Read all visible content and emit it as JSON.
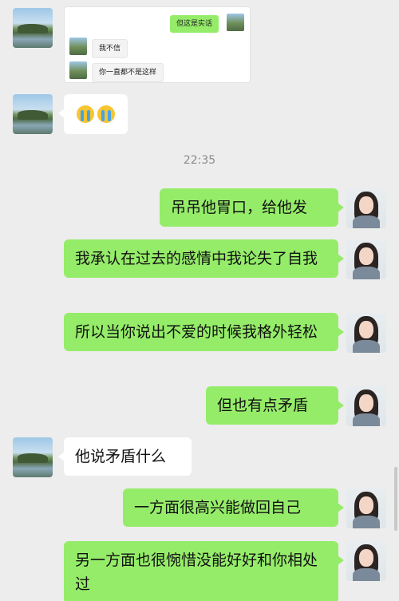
{
  "quote": {
    "sent_text": "但这是实话",
    "reply1": "我不信",
    "reply2": "你一直都不是这样"
  },
  "emoji_message": {
    "icon": "crying-face-icon"
  },
  "timestamp": "22:35",
  "messages": [
    {
      "side": "right",
      "text": "吊吊他胃口，给他发"
    },
    {
      "side": "right",
      "text": "我承认在过去的感情中我论失了自我"
    },
    {
      "side": "right",
      "text": "所以当你说出不爱的时候我格外轻松"
    },
    {
      "side": "right",
      "text": "但也有点矛盾"
    },
    {
      "side": "left",
      "text": "他说矛盾什么"
    },
    {
      "side": "right",
      "text": "一方面很高兴能做回自己"
    },
    {
      "side": "right",
      "text": "另一方面也很惋惜没能好好和你相处过"
    }
  ],
  "colors": {
    "background": "#ededed",
    "sent_bubble": "#95ec69",
    "received_bubble": "#ffffff",
    "timestamp_text": "#8a8a8a"
  }
}
